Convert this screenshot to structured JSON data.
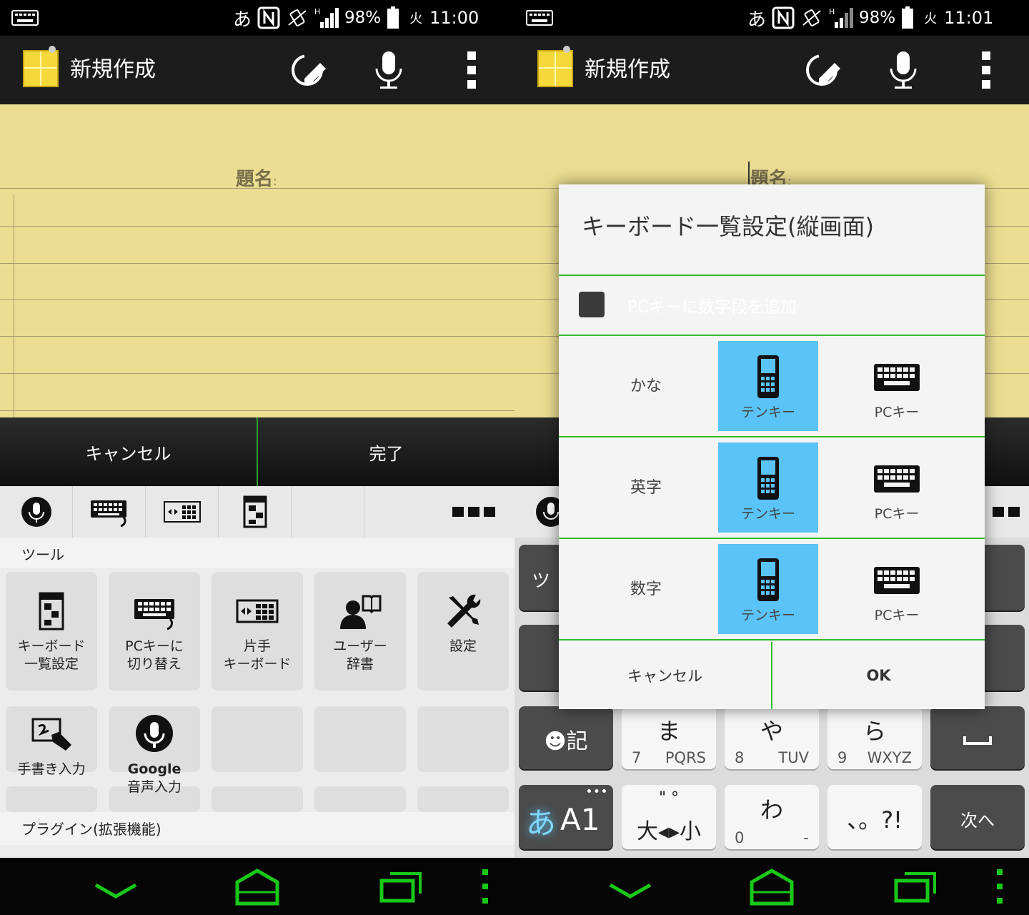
{
  "left": {
    "status": {
      "ime": "あ",
      "battery": "98%",
      "day": "火",
      "time": "11:00"
    },
    "appbar": {
      "title": "新規作成"
    },
    "memo": {
      "title_label": "題名",
      "colon": ":"
    },
    "actions": {
      "cancel": "キャンセル",
      "done": "完了"
    },
    "sections": {
      "tools": "ツール",
      "plugins": "プラグイン(拡張機能)"
    },
    "tools": [
      {
        "label1": "キーボード",
        "label2": "一覧設定"
      },
      {
        "label1": "PCキーに",
        "label2": "切り替え"
      },
      {
        "label1": "片手",
        "label2": "キーボード"
      },
      {
        "label1": "ユーザー",
        "label2": "辞書"
      },
      {
        "label1": "設定",
        "label2": ""
      },
      {
        "label1": "手書き入力",
        "label2": ""
      },
      {
        "label1": "Google",
        "label2": "音声入力"
      }
    ]
  },
  "right": {
    "status": {
      "ime": "あ",
      "battery": "98%",
      "day": "火",
      "time": "11:01"
    },
    "appbar": {
      "title": "新規作成"
    },
    "memo": {
      "title_label": "題名",
      "colon": ":"
    },
    "dialog": {
      "title": "キーボード一覧設定(縦画面)",
      "checkbox_label": "PCキーに数字段を追加",
      "rows": [
        {
          "label": "かな",
          "opt1": "テンキー",
          "opt2": "PCキー"
        },
        {
          "label": "英字",
          "opt1": "テンキー",
          "opt2": "PCキー"
        },
        {
          "label": "数字",
          "opt1": "テンキー",
          "opt2": "PCキー"
        }
      ],
      "cancel": "キャンセル",
      "ok": "OK"
    },
    "keys": {
      "emoji": "☻記",
      "ma": "ま",
      "ma_num": "7",
      "ma_sub": "PQRS",
      "ya": "や",
      "ya_num": "8",
      "ya_sub": "TUV",
      "ra": "ら",
      "ra_num": "9",
      "ra_sub": "WXYZ",
      "mode_kana": "あ",
      "mode_alnum": "A1",
      "dakuten_top": "\" °",
      "dakuten": "大◂▸小",
      "wa": "わ",
      "wa_num": "0",
      "wa_sub": "-",
      "punct": "、。?!",
      "next": "次へ",
      "tool_partial": "ツ"
    }
  },
  "colors": {
    "accent_green": "#33bb33",
    "selected_blue": "#5ac3f7",
    "paper": "#ebdd91",
    "nav_green": "#19c819"
  }
}
